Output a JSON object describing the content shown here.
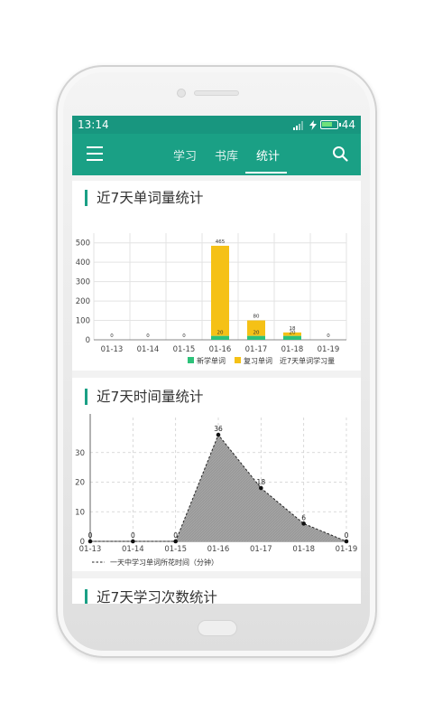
{
  "status": {
    "time": "13:14",
    "battery": "44"
  },
  "appbar": {
    "tabs": [
      {
        "label": "学习"
      },
      {
        "label": "书库"
      },
      {
        "label": "统计"
      }
    ],
    "active_tab": "统计"
  },
  "sections": {
    "words": {
      "title": "近7天单词量统计"
    },
    "time": {
      "title": "近7天时间量统计"
    },
    "count": {
      "title": "近7天学习次数统计"
    }
  },
  "chart_data": [
    {
      "type": "bar",
      "title": "",
      "categories": [
        "01-13",
        "01-14",
        "01-15",
        "01-16",
        "01-17",
        "01-18",
        "01-19"
      ],
      "series": [
        {
          "name": "新学单词",
          "values": [
            0,
            0,
            0,
            20,
            20,
            20,
            0
          ],
          "color": "#2dc27a"
        },
        {
          "name": "复习单词",
          "values": [
            0,
            0,
            0,
            465,
            80,
            18,
            0
          ],
          "color": "#f5c116"
        }
      ],
      "total_labels": [
        "0",
        "0",
        "0",
        "465",
        "80",
        "18",
        "0"
      ],
      "new_labels": [
        "",
        "",
        "",
        "20",
        "20",
        "20",
        ""
      ],
      "legend_extra": "近7天单词学习量",
      "yticks": [
        0,
        100,
        200,
        300,
        400,
        500
      ],
      "ylim": [
        0,
        550
      ],
      "stacked": true,
      "grid": true,
      "legend": "bottom-right"
    },
    {
      "type": "area",
      "title": "",
      "categories": [
        "01-13",
        "01-14",
        "01-15",
        "01-16",
        "01-17",
        "01-18",
        "01-19"
      ],
      "series": [
        {
          "name": "一天中学习单词所花时间（分钟）",
          "values": [
            0,
            0,
            0,
            36,
            18,
            6,
            0
          ],
          "color": "#9e9e9e"
        }
      ],
      "yticks": [
        0,
        10,
        20,
        30
      ],
      "ylim": [
        0,
        40
      ],
      "grid": true,
      "legend": "bottom-left"
    }
  ]
}
